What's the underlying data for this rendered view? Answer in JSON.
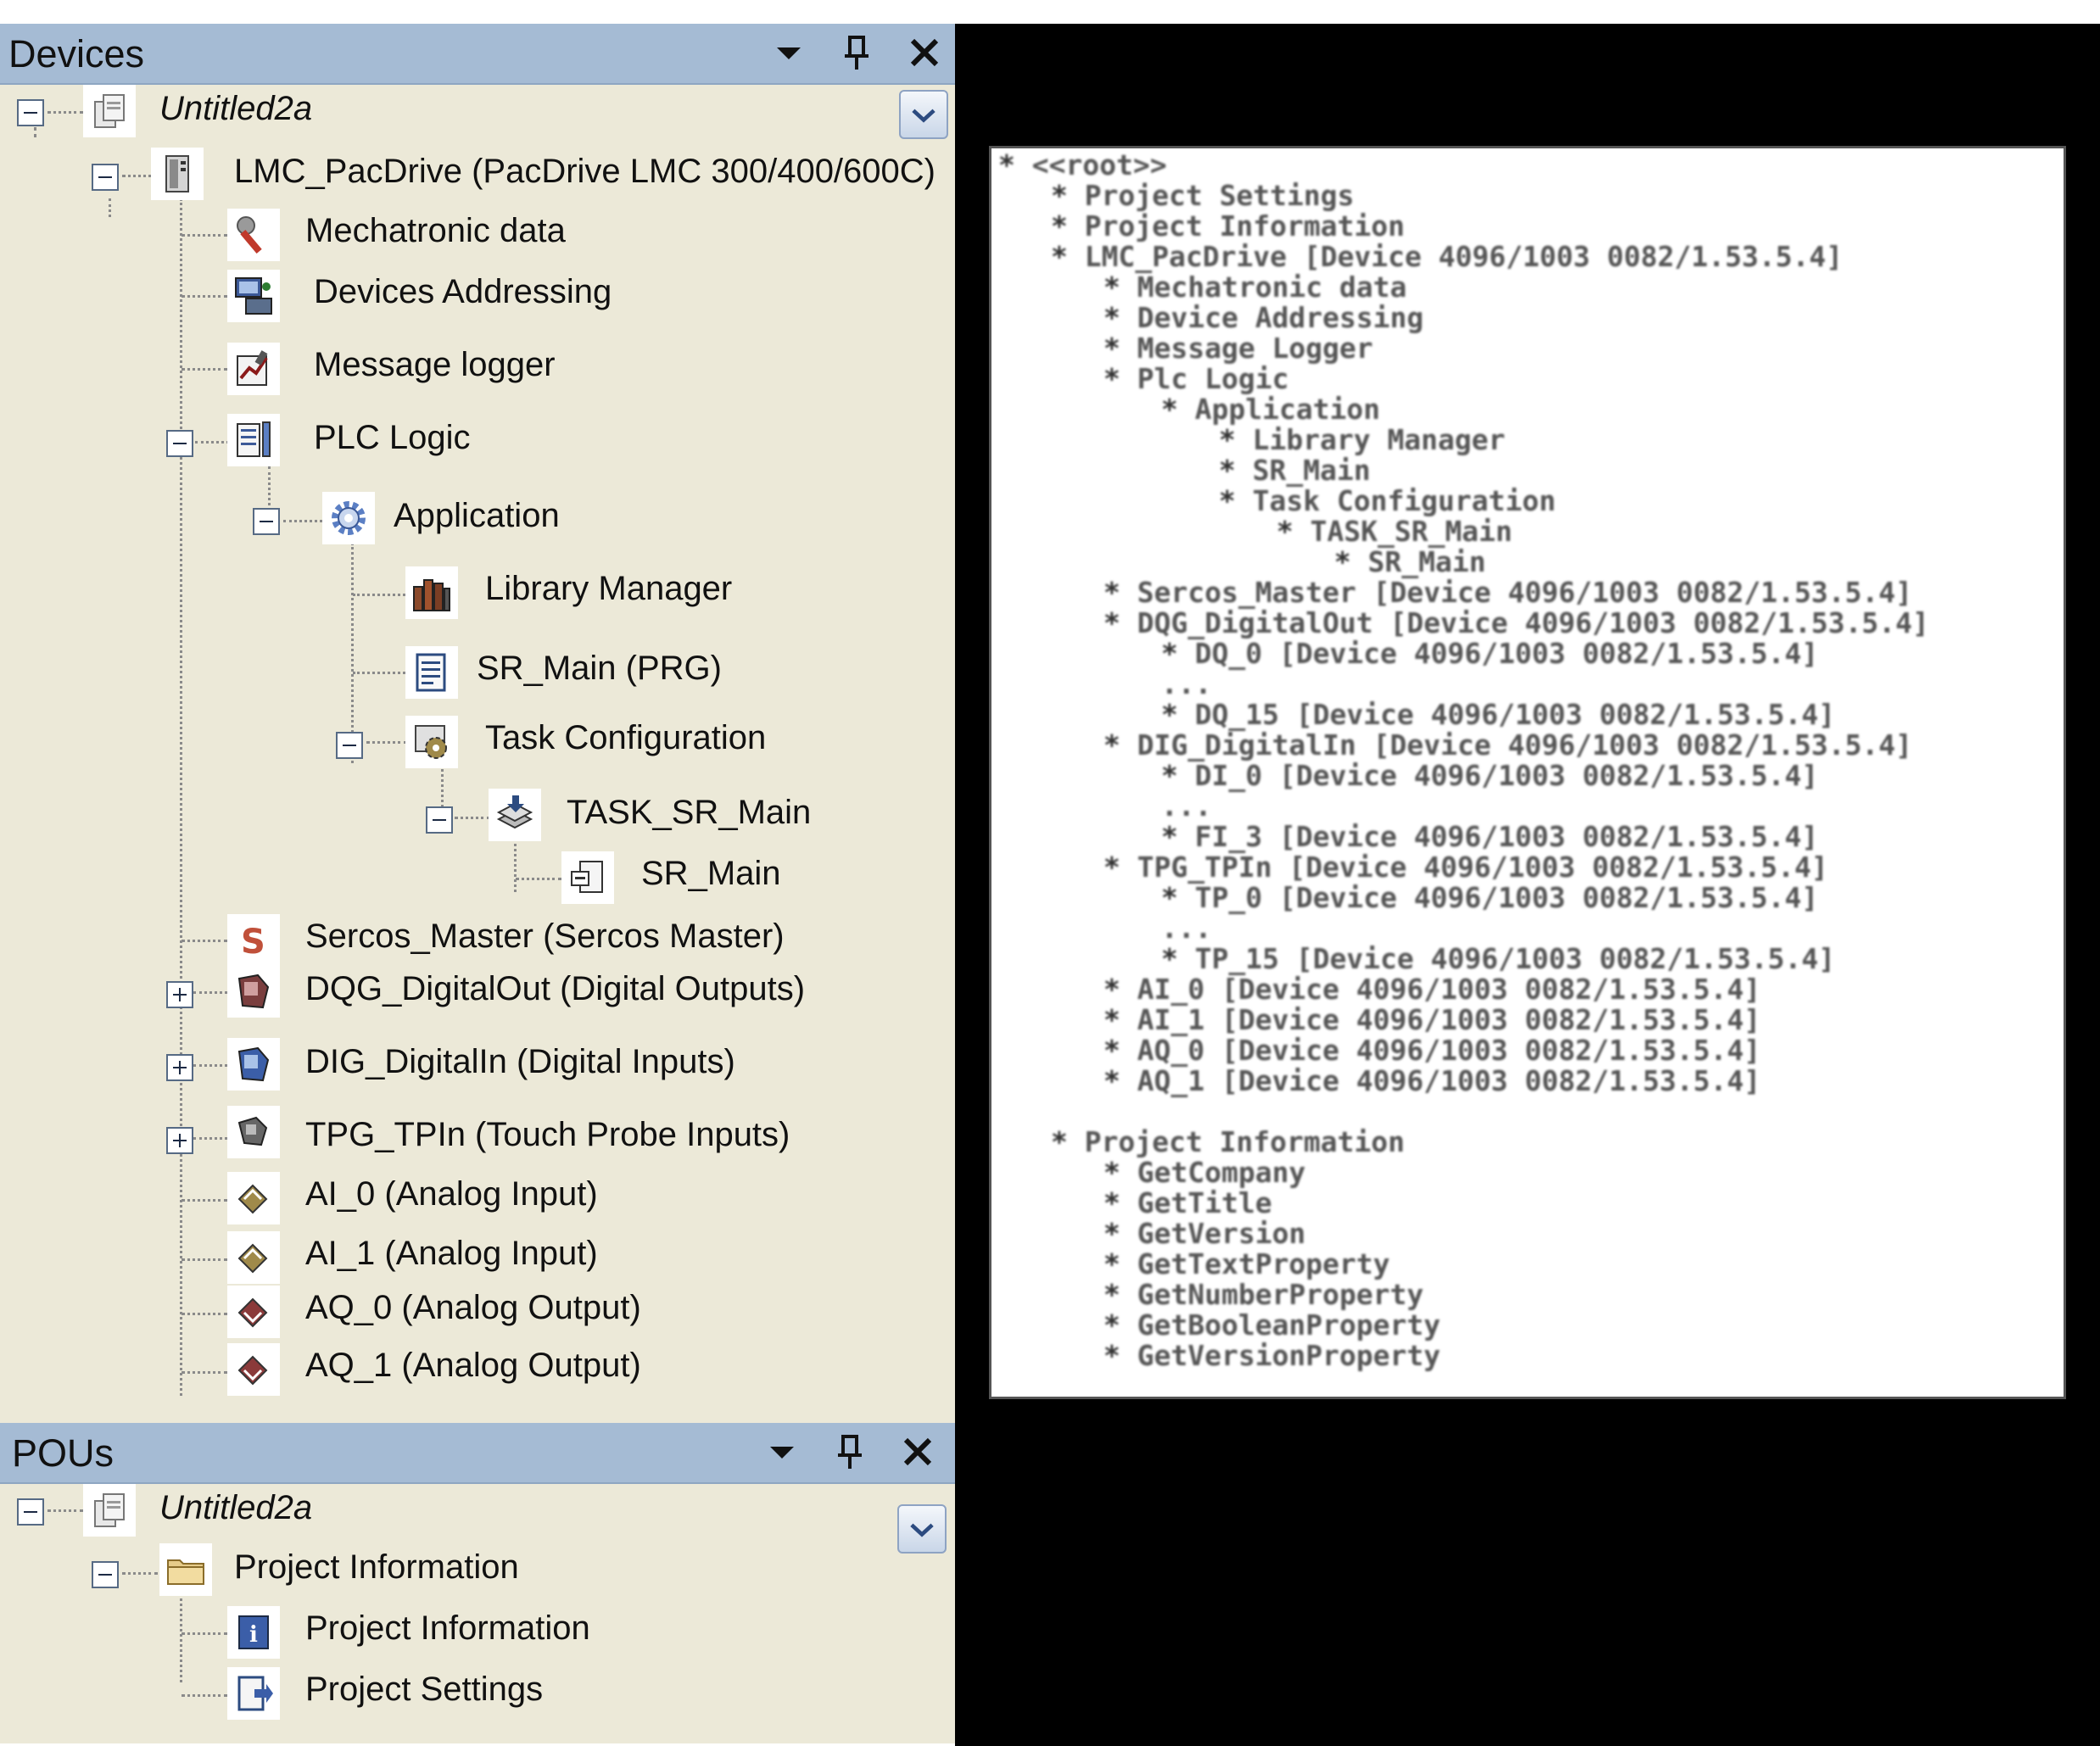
{
  "devices_panel": {
    "title": "Devices",
    "tree": [
      {
        "label": "Untitled2a",
        "icon": "project-icon",
        "expander": "minus"
      },
      {
        "label": "LMC_PacDrive (PacDrive LMC 300/400/600C)",
        "icon": "controller-icon",
        "expander": "minus"
      },
      {
        "label": "Mechatronic data",
        "icon": "wrench-icon"
      },
      {
        "label": "Devices Addressing",
        "icon": "network-icon"
      },
      {
        "label": "Message logger",
        "icon": "logger-icon"
      },
      {
        "label": "PLC Logic",
        "icon": "plc-logic-icon",
        "expander": "minus"
      },
      {
        "label": "Application",
        "icon": "gear-icon",
        "expander": "minus"
      },
      {
        "label": "Library Manager",
        "icon": "books-icon"
      },
      {
        "label": "SR_Main (PRG)",
        "icon": "document-icon"
      },
      {
        "label": "Task Configuration",
        "icon": "task-config-icon",
        "expander": "minus"
      },
      {
        "label": "TASK_SR_Main",
        "icon": "task-icon",
        "expander": "minus"
      },
      {
        "label": "SR_Main",
        "icon": "program-call-icon"
      },
      {
        "label": "Sercos_Master (Sercos Master)",
        "icon": "sercos-icon"
      },
      {
        "label": "DQG_DigitalOut (Digital Outputs)",
        "icon": "digital-out-icon",
        "expander": "plus"
      },
      {
        "label": "DIG_DigitalIn (Digital Inputs)",
        "icon": "digital-in-icon",
        "expander": "plus"
      },
      {
        "label": "TPG_TPIn (Touch Probe Inputs)",
        "icon": "touch-probe-icon",
        "expander": "plus"
      },
      {
        "label": "AI_0 (Analog Input)",
        "icon": "analog-in-icon"
      },
      {
        "label": "AI_1 (Analog Input)",
        "icon": "analog-in-icon"
      },
      {
        "label": "AQ_0 (Analog Output)",
        "icon": "analog-out-icon"
      },
      {
        "label": "AQ_1 (Analog Output)",
        "icon": "analog-out-icon"
      }
    ]
  },
  "pous_panel": {
    "title": "POUs",
    "tree": [
      {
        "label": "Untitled2a",
        "icon": "project-icon",
        "expander": "minus"
      },
      {
        "label": "Project Information",
        "icon": "folder-icon",
        "expander": "minus"
      },
      {
        "label": "Project Information",
        "icon": "info-icon"
      },
      {
        "label": "Project Settings",
        "icon": "settings-doc-icon"
      }
    ]
  },
  "header_icons": [
    "dropdown-icon",
    "pin-icon",
    "close-icon"
  ],
  "info_document": [
    "<<root>>",
    "Project Settings",
    "Project Information",
    "LMC_PacDrive [Device 4096/1003 0082/1.53.5.4]",
    "Mechatronic data",
    "Device Addressing",
    "Message Logger",
    "Plc Logic",
    "Application",
    "Library Manager",
    "SR_Main",
    "Task Configuration",
    "TASK_SR_Main",
    "SR_Main",
    "Sercos_Master [Device 4096/1003 0082/1.53.5.4]",
    "DQG_DigitalOut [Device 4096/1003 0082/1.53.5.4]",
    "DQ_0 [Device 4096/1003 0082/1.53.5.4]",
    "...",
    "DQ_15 [Device 4096/1003 0082/1.53.5.4]",
    "DIG_DigitalIn [Device 4096/1003 0082/1.53.5.4]",
    "DI_0 [Device 4096/1003 0082/1.53.5.4]",
    "...",
    "FI_3 [Device 4096/1003 0082/1.53.5.4]",
    "TPG_TPIn [Device 4096/1003 0082/1.53.5.4]",
    "TP_0 [Device 4096/1003 0082/1.53.5.4]",
    "...",
    "TP_15 [Device 4096/1003 0082/1.53.5.4]",
    "AI_0 [Device 4096/1003 0082/1.53.5.4]",
    "AI_1 [Device 4096/1003 0082/1.53.5.4]",
    "AQ_0 [Device 4096/1003 0082/1.53.5.4]",
    "AQ_1 [Device 4096/1003 0082/1.53.5.4]",
    "Project Information",
    "GetCompany",
    "GetTitle",
    "GetVersion",
    "GetTextProperty",
    "GetNumberProperty",
    "GetBooleanProperty",
    "GetVersionProperty"
  ],
  "colors": {
    "header": "#a5bbd4",
    "panel": "#ece9d8",
    "background": "#000000"
  }
}
